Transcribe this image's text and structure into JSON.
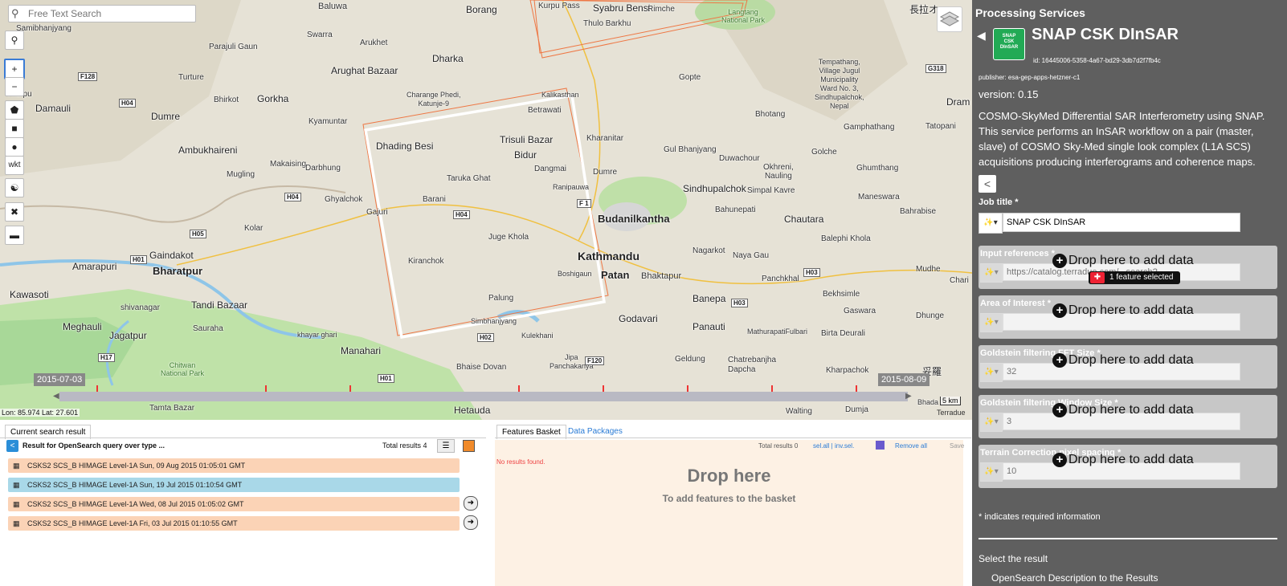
{
  "map": {
    "search_placeholder": "Free Text Search",
    "tools": {
      "zoom_in": "+",
      "zoom_out": "−",
      "wkt": "wkt"
    },
    "places": {
      "baluwa": "Baluwa",
      "borang": "Borang",
      "kurpu": "Kurpu Pass",
      "syabru": "Syabru Bensi",
      "rimche": "Rimche",
      "langtang": "Langtang\nNational Park",
      "kanji": "長拉オ",
      "samibhanjyang": "Samibhanjyang",
      "swarra": "Swarra",
      "arukhet": "Arukhet",
      "dharka": "Dharka",
      "thulo": "Thulo Barkhu",
      "parajuli": "Parajuli Gaun",
      "arughat": "Arughat Bazaar",
      "tharpu": "Tharpu",
      "turture": "Turture",
      "gopte": "Gopte",
      "tempathang": "Tempathang,\nVillage Jugul\nMunicipality\nWard No. 3,\nSindhupalchok,\nNepal",
      "dram": "Dram",
      "damauli": "Damauli",
      "dumre1": "Dumre",
      "bhirkot": "Bhirkot",
      "gorkha": "Gorkha",
      "charange": "Charange Phedi,\nKatunje-9",
      "kalikasthan": "Kalikasthan",
      "betrawati": "Betrawati",
      "bhotang": "Bhotang",
      "kyamuntar": "Kyamuntar",
      "gamphathang": "Gamphathang",
      "tatopani": "Tatopani",
      "ambukhaireni": "Ambukhaireni",
      "dhading": "Dhading Besi",
      "trisuli": "Trisuli Bazar",
      "bidur": "Bidur",
      "kharanitar": "Kharanitar",
      "gul": "Gul Bhanjyang",
      "duwachour": "Duwachour",
      "golche": "Golche",
      "makaising": "Makaising",
      "darbhung": "Darbhung",
      "dangmai": "Dangmai",
      "dumre2": "Dumre",
      "okhreni": "Okhreni,\nNauling",
      "ghumthang": "Ghumthang",
      "mugling": "Mugling",
      "taruka": "Taruka Ghat",
      "ranipauwa": "Ranipauwa",
      "sindhupalchok": "Sindhupalchok",
      "simpal": "Simpal Kavre",
      "maneswara": "Maneswara",
      "bahrabise": "Bahrabise",
      "ghyalchok": "Ghyalchok",
      "barani": "Barani",
      "gajuri": "Gajuri",
      "budanilkantha": "Budanilkantha",
      "bahunepati": "Bahunepati",
      "chautara": "Chautara",
      "kolar": "Kolar",
      "juge": "Juge Khola",
      "kathmandu": "Kathmandu",
      "balephi": "Balephi Khola",
      "gaindakot": "Gaindakot",
      "nagarkot": "Nagarkot",
      "naya": "Naya Gau",
      "amarapuri": "Amarapuri",
      "bharatpur": "Bharatpur",
      "kiranchok": "Kiranchok",
      "patan": "Patan",
      "bhaktapur": "Bhaktapur",
      "boshigaun": "Boshigaun",
      "panchkhal": "Panchkhal",
      "mudhe": "Mudhe",
      "chari": "Chari",
      "kawasoti": "Kawasoti",
      "shivanagar": "shivanagar",
      "tandi": "Tandi Bazaar",
      "palung": "Palung",
      "godavari": "Godavari",
      "banepa": "Banepa",
      "bekhsimle": "Bekhsimle",
      "simbhanjyang": "Simbhanjyang",
      "meghauli": "Meghauli",
      "jagatpur": "Jagatpur",
      "sauraha": "Sauraha",
      "khayar": "khayar ghari",
      "kulekhani": "Kulekhani",
      "panauti": "Panauti",
      "mathurapati": "MathurapatiFulbari",
      "birta": "Birta Deurali",
      "gaswara": "Gaswara",
      "dhunge": "Dhunge",
      "manahari": "Manahari",
      "chitwan": "Chitwan\nNational Park",
      "bhaise": "Bhaise Dovan",
      "geldung": "Geldung",
      "chatrebanjha": "Chatrebanjha\nDapcha",
      "kharpachok": "Kharpachok",
      "jipa": "Jipa\nPanchakanya",
      "tamta": "Tamta Bazar",
      "hetauda": "Hetauda",
      "walting": "Walting",
      "dumja": "Dumja",
      "bhada": "Bhada",
      "kanji2": "妥羅"
    },
    "roads": {
      "f128": "F128",
      "h04a": "H04",
      "h04b": "H04",
      "h04c": "H04",
      "h05": "H05",
      "h01a": "H01",
      "h01b": "H01",
      "h17": "H17",
      "h02": "H02",
      "f120": "F120",
      "h03a": "H03",
      "h03b": "H03",
      "g318": "G318",
      "f1": "F 1"
    },
    "date_start": "2015-07-03",
    "date_end": "2015-08-09",
    "coords": "Lon: 85.974  Lat: 27.601",
    "scale": "5 km",
    "attribution": "Terradue"
  },
  "results": {
    "tab": "Current search result",
    "query": "Result for OpenSearch query over type ...",
    "total": "Total results  4",
    "items": [
      {
        "label": "CSKS2 SCS_B HIMAGE Level-1A Sun, 09 Aug 2015 01:05:01 GMT",
        "color": "#fbd3b6"
      },
      {
        "label": "CSKS2 SCS_B HIMAGE Level-1A Sun, 19 Jul 2015 01:10:54 GMT",
        "color": "#a9d8e8"
      },
      {
        "label": "CSKS2 SCS_B HIMAGE Level-1A Wed, 08 Jul 2015 01:05:02 GMT",
        "color": "#fbd3b6"
      },
      {
        "label": "CSKS2 SCS_B HIMAGE Level-1A Fri, 03 Jul 2015 01:10:55 GMT",
        "color": "#fbd3b6"
      }
    ]
  },
  "basket": {
    "tab_features": "Features Basket",
    "tab_packages": "Data Packages",
    "total": "Total results  0",
    "sel_all": "sel.all",
    "inv_sel": "inv.sel.",
    "remove_all": "Remove all",
    "save": "Save",
    "no_results": "No results found.",
    "drop_here": "Drop here",
    "drop_sub": "To add features to the basket"
  },
  "panel": {
    "header": "Processing Services",
    "service_title": "SNAP CSK DInSAR",
    "logo_text": "SNAP\nCSK\nDInSAR",
    "id": "id: 16445006-5358-4a67-bd29-3db7d2f7fb4c",
    "publisher": "publisher: esa-gep-apps-hetzner-c1",
    "version": "version: 0.15",
    "description": "COSMO-SkyMed Differential SAR Interferometry using SNAP. This service performs an InSAR workflow on a pair (master, slave) of COSMO Sky-Med single look complex (L1A SCS) acquisitions producing interferograms and coherence maps.",
    "job_title_label": "Job title *",
    "job_title_value": "SNAP CSK DInSAR",
    "drop_label": "Drop here to add data",
    "feature_selected": "1 feature selected",
    "fields": [
      {
        "label": "Input references *",
        "placeholder": "https://catalog.terradue.com/...search?"
      },
      {
        "label": "Area of Interest *",
        "placeholder": ""
      },
      {
        "label": "Goldstein filtering FFT Size *",
        "placeholder": "32"
      },
      {
        "label": "Goldstein filtering Window Size *",
        "placeholder": "3"
      },
      {
        "label": "Terrain Correction pixel spacing *",
        "placeholder": "10"
      }
    ],
    "required_note": "* indicates required information",
    "select_result": "Select the result",
    "opensearch_desc": "OpenSearch Description to the Results"
  }
}
